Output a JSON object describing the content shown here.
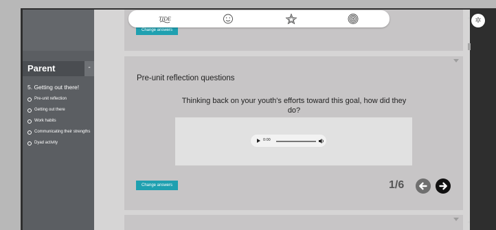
{
  "sidebar": {
    "title": "Parent",
    "toggle": "-",
    "unit_title": "5. Getting out there!",
    "items": [
      {
        "label": "Pre-unit reflection"
      },
      {
        "label": "Getting out there"
      },
      {
        "label": "Work habits"
      },
      {
        "label": "Communicating their strengths"
      },
      {
        "label": "Dyad activity"
      }
    ]
  },
  "topbar": {
    "icons": [
      "tide-logo-icon",
      "smiley-face-icon",
      "star-icon",
      "target-icon"
    ],
    "logo_text": "TIDE"
  },
  "top_card": {
    "change_answers_label": "Change answers"
  },
  "main_card": {
    "title": "Pre-unit reflection questions",
    "question": "Thinking back on your youth's efforts toward this goal, how did they do?",
    "audio": {
      "time": "0:00"
    },
    "change_answers_label": "Change answers",
    "page_counter": "1/6"
  },
  "colors": {
    "accent": "#1fa0b0",
    "sidebar_bg": "#5b5e62",
    "card_bg": "#c7c5c6"
  }
}
